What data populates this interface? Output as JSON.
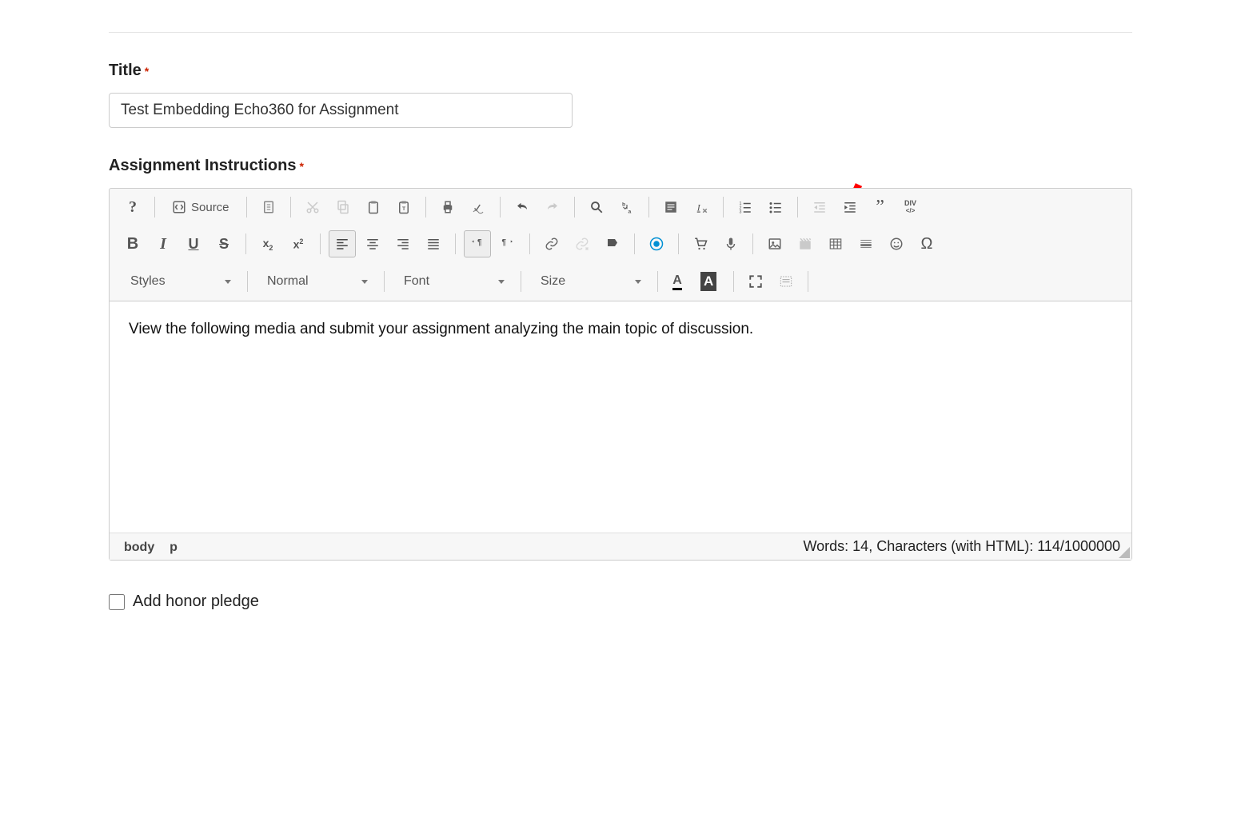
{
  "title": {
    "label": "Title",
    "value": "Test Embedding Echo360 for Assignment"
  },
  "instructions": {
    "label": "Assignment Instructions",
    "content": "View the following media and submit your assignment analyzing the main topic of discussion."
  },
  "toolbar": {
    "source": "Source",
    "styles": "Styles",
    "format": "Normal",
    "font": "Font",
    "size": "Size",
    "div_label_top": "DIV",
    "div_label_bottom": "</>"
  },
  "status": {
    "path_body": "body",
    "path_p": "p",
    "words": "Words: 14, Characters (with HTML): 114/1000000"
  },
  "honor": {
    "label": "Add honor pledge"
  },
  "colors": {
    "record_icon": "#0090d4",
    "arrow": "#ff0000"
  }
}
